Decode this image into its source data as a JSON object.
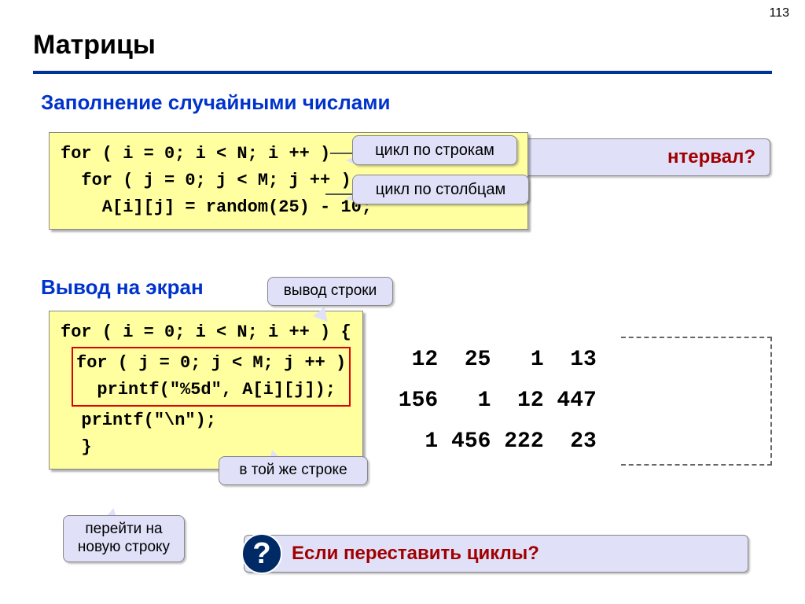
{
  "page_number": "113",
  "title": "Матрицы",
  "subtitle1": "Заполнение случайными числами",
  "subtitle2": "Вывод на экран",
  "code1_line1": "for ( i = 0; i < N; i ++ )",
  "code1_line2": "  for ( j = 0; j < M; j ++ )",
  "code1_line3": "    A[i][j] = random(25) - 10;",
  "code2_line1": "for ( i = 0; i < N; i ++ ) {",
  "code2_inner1": "for ( j = 0; j < M; j ++ )",
  "code2_inner2": "  printf(\"%5d\", A[i][j]);",
  "code2_line4": "  printf(\"\\n\");",
  "code2_line5": "  }",
  "callout_rows": "цикл по строкам",
  "callout_cols": "цикл по столбцам",
  "callout_outrow": "вывод строки",
  "callout_sameline": "в той же строке",
  "callout_newline": "перейти на новую строку",
  "question1_partial": "нтервал?",
  "question2": "Если переставить циклы?",
  "qmark": "?",
  "matrix_text": "  12  25   1  13\n 156   1  12 447\n   1 456 222  23"
}
